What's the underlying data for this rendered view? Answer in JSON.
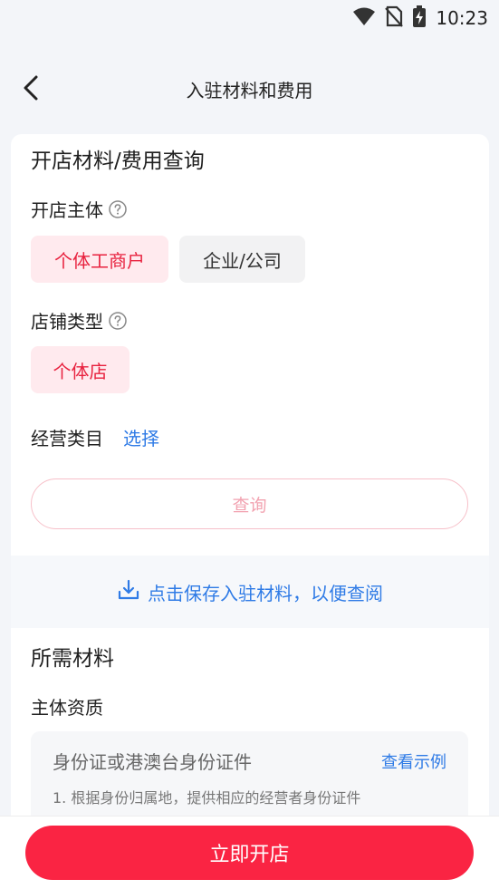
{
  "status_bar": {
    "time": "10:23",
    "icons": [
      "wifi-icon",
      "no-sim-icon",
      "battery-charging-icon"
    ]
  },
  "header": {
    "title": "入驻材料和费用",
    "back_icon": "chevron-left-icon"
  },
  "query_card": {
    "title": "开店材料/费用查询",
    "subject": {
      "label": "开店主体",
      "options": [
        {
          "label": "个体工商户",
          "selected": true
        },
        {
          "label": "企业/公司",
          "selected": false
        }
      ]
    },
    "store_type": {
      "label": "店铺类型",
      "options": [
        {
          "label": "个体店",
          "selected": true
        }
      ]
    },
    "category": {
      "label": "经营类目",
      "action": "选择"
    },
    "query_button": "查询"
  },
  "save_banner": {
    "text": "点击保存入驻材料，以便查阅",
    "icon": "download-icon"
  },
  "materials": {
    "title": "所需材料",
    "subtitle": "主体资质",
    "item": {
      "name": "身份证或港澳台身份证件",
      "example_link": "查看示例",
      "description": "1. 根据身份归属地，提供相应的经营者身份证件"
    }
  },
  "bottom_bar": {
    "button": "立即开店"
  },
  "colors": {
    "accent_red": "#fa2443",
    "link_blue": "#2f7be6",
    "chip_active_bg": "#ffeaee"
  }
}
